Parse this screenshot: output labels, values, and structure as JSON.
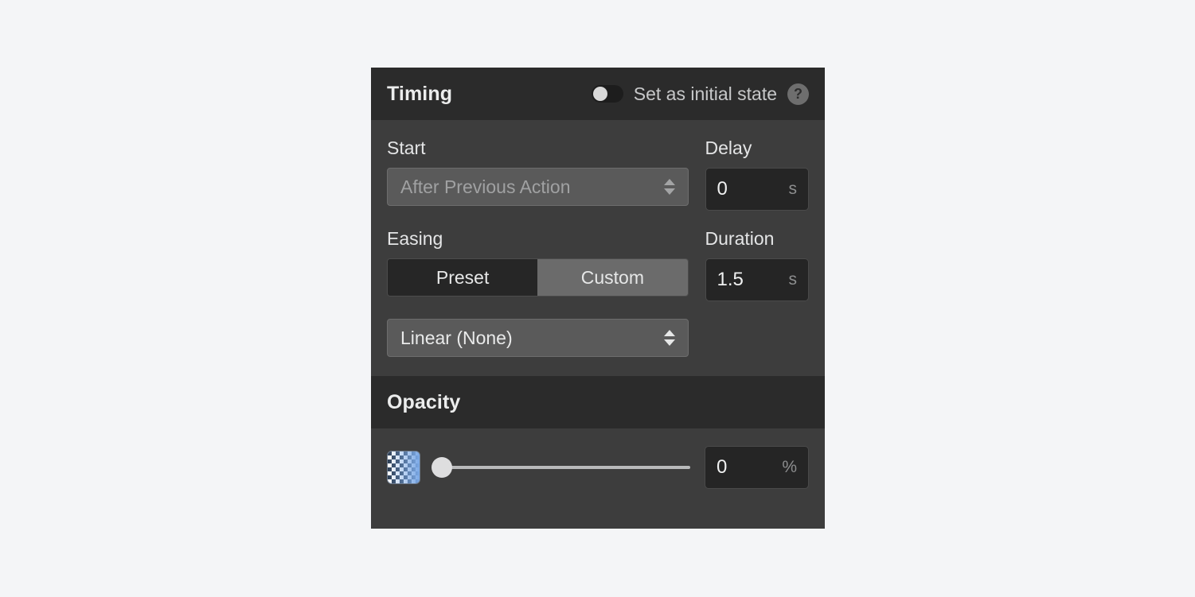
{
  "panel": {
    "timing": {
      "title": "Timing",
      "toggle": {
        "label": "Set as initial state",
        "state": "off"
      },
      "help_icon": "?",
      "start": {
        "label": "Start",
        "value": "After Previous Action",
        "enabled": false
      },
      "delay": {
        "label": "Delay",
        "value": "0",
        "unit": "s"
      },
      "easing": {
        "label": "Easing",
        "options": [
          {
            "label": "Preset",
            "selected": false
          },
          {
            "label": "Custom",
            "selected": true
          }
        ],
        "curve": "Linear (None)"
      },
      "duration": {
        "label": "Duration",
        "value": "1.5",
        "unit": "s"
      }
    },
    "opacity": {
      "title": "Opacity",
      "slider_value": 0,
      "value": "0",
      "unit": "%"
    }
  },
  "colors": {
    "panel_bg": "#3d3d3d",
    "header_bg": "#2b2b2b",
    "field_bg": "#252525",
    "select_bg": "#5a5a5a",
    "segment_active": "#6b6b6b",
    "swatch_accent": "#7ba9e6",
    "page_bg": "#f4f5f7"
  }
}
